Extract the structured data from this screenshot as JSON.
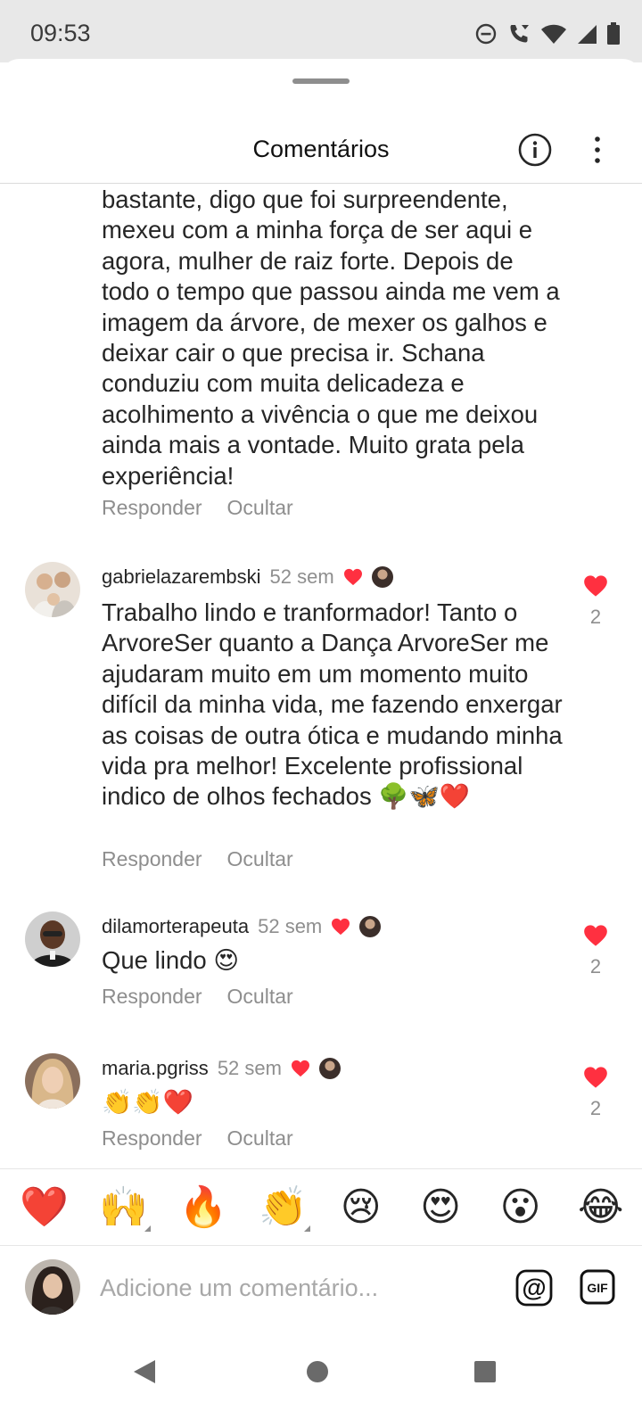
{
  "status_bar": {
    "time": "09:53",
    "icons": [
      "do-not-disturb-icon",
      "wifi-calling-icon",
      "wifi-icon",
      "signal-icon",
      "battery-icon"
    ]
  },
  "header": {
    "title": "Comentários",
    "info_icon": "info-icon",
    "more_icon": "more-vertical-icon"
  },
  "continuation": {
    "text": "bastante, digo que foi surpreendente, mexeu com a minha força de ser aqui e agora, mulher de raiz forte. Depois de todo o tempo que passou ainda me vem a imagem da árvore, de mexer os galhos e deixar cair o que precisa ir. Schana conduziu com muita delicadeza e acolhimento a vivência o que me deixou ainda mais a vontade. Muito grata pela experiência!",
    "reply_label": "Responder",
    "hide_label": "Ocultar"
  },
  "comments": [
    {
      "username": "gabrielazarembski",
      "time": "52 sem",
      "text": "Trabalho lindo e tranformador! Tanto o ArvoreSer quanto a Dança ArvoreSer me ajudaram muito em um momento muito difícil da minha vida, me fazendo enxergar as coisas de outra ótica e mudando minha vida pra melhor! Excelente profissional indico de olhos fechados 🌳🦋❤️",
      "likes": "2",
      "reply_label": "Responder",
      "hide_label": "Ocultar"
    },
    {
      "username": "dilamorterapeuta",
      "time": "52 sem",
      "text": "Que lindo 😍",
      "likes": "2",
      "reply_label": "Responder",
      "hide_label": "Ocultar"
    },
    {
      "username": "maria.pgriss",
      "time": "52 sem",
      "text": "👏👏❤️",
      "likes": "2",
      "reply_label": "Responder",
      "hide_label": "Ocultar"
    }
  ],
  "emoji_bar": [
    "❤️",
    "🙌",
    "🔥",
    "👏",
    "😢",
    "😍",
    "😮",
    "😂"
  ],
  "comment_input": {
    "placeholder": "Adicione um comentário..."
  },
  "colors": {
    "like_red": "#ff3040",
    "secondary_text": "#8e8e8e",
    "primary_text": "#262626"
  }
}
